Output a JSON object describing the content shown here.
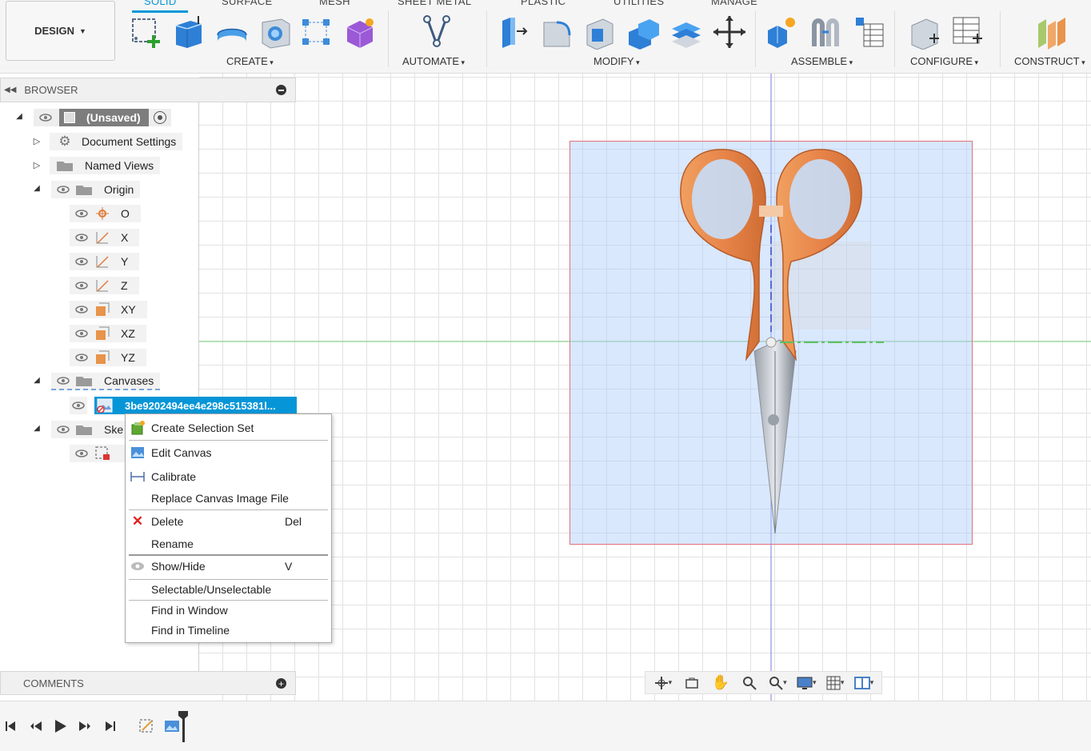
{
  "toolbar": {
    "workspace": "DESIGN",
    "tabs": [
      "SOLID",
      "SURFACE",
      "MESH",
      "SHEET METAL",
      "PLASTIC",
      "UTILITIES",
      "MANAGE"
    ],
    "groups": [
      "CREATE",
      "AUTOMATE",
      "MODIFY",
      "ASSEMBLE",
      "CONFIGURE",
      "CONSTRUCT"
    ]
  },
  "browser": {
    "title": "BROWSER",
    "root": "(Unsaved)",
    "items": [
      "Document Settings",
      "Named Views",
      "Origin",
      "O",
      "X",
      "Y",
      "Z",
      "XY",
      "XZ",
      "YZ",
      "Canvases",
      "3be9202494ee4e298c515381l...",
      "Ske"
    ]
  },
  "context_menu": {
    "items": [
      {
        "label": "Create Selection Set",
        "shortcut": ""
      },
      {
        "label": "Edit Canvas",
        "shortcut": ""
      },
      {
        "label": "Calibrate",
        "shortcut": ""
      },
      {
        "label": "Replace Canvas Image File",
        "shortcut": ""
      },
      {
        "label": "Delete",
        "shortcut": "Del"
      },
      {
        "label": "Rename",
        "shortcut": ""
      },
      {
        "label": "Show/Hide",
        "shortcut": "V"
      },
      {
        "label": "Selectable/Unselectable",
        "shortcut": ""
      },
      {
        "label": "Find in Window",
        "shortcut": ""
      },
      {
        "label": "Find in Timeline",
        "shortcut": ""
      }
    ]
  },
  "comments": {
    "title": "COMMENTS"
  },
  "colors": {
    "accent": "#0696d7",
    "selection": "#0696d7",
    "canvas_border": "#e0707c"
  }
}
